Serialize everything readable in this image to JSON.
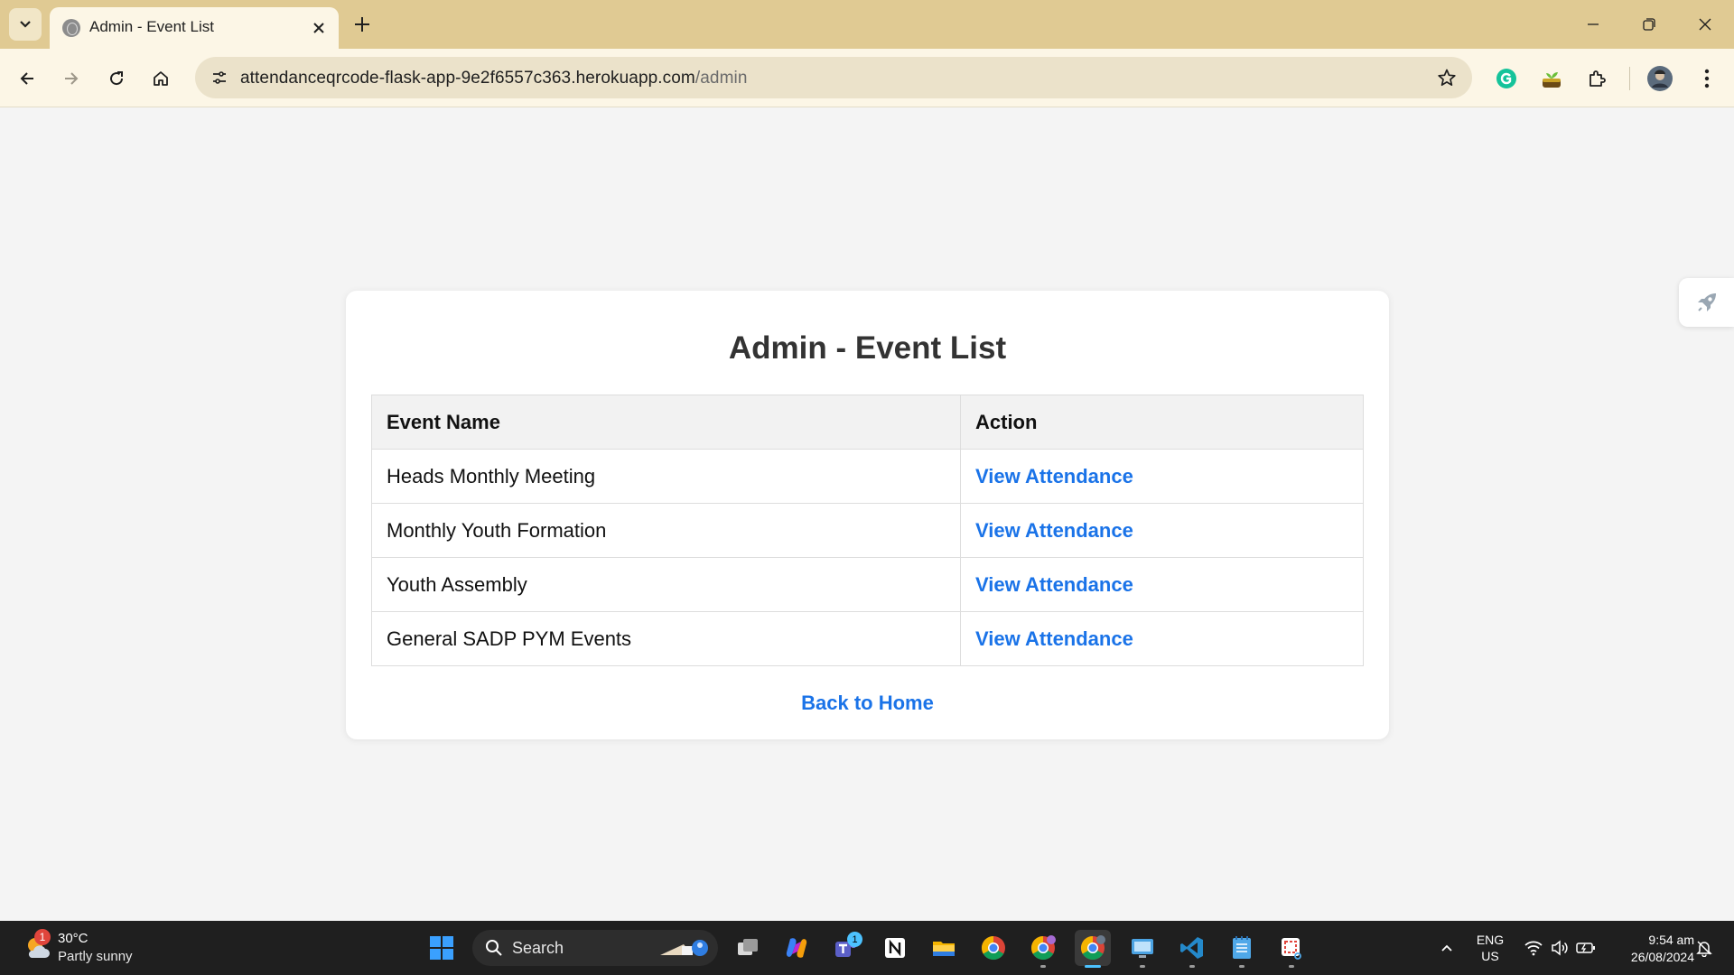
{
  "browser": {
    "tab_title": "Admin - Event List",
    "url_host": "attendanceqrcode-flask-app-9e2f6557c363.herokuapp.com",
    "url_path": "/admin"
  },
  "page": {
    "title": "Admin - Event List",
    "table": {
      "headers": [
        "Event Name",
        "Action"
      ],
      "rows": [
        {
          "event": "Heads Monthly Meeting",
          "action": "View Attendance"
        },
        {
          "event": "Monthly Youth Formation",
          "action": "View Attendance"
        },
        {
          "event": "Youth Assembly",
          "action": "View Attendance"
        },
        {
          "event": "General SADP PYM Events",
          "action": "View Attendance"
        }
      ]
    },
    "back_link": "Back to Home",
    "link_color": "#1a73e8"
  },
  "taskbar": {
    "weather": {
      "temp": "30°C",
      "condition": "Partly sunny",
      "badge": "1"
    },
    "search_label": "Search",
    "teams_badge": "1",
    "language": {
      "line1": "ENG",
      "line2": "US"
    },
    "clock": {
      "time": "9:54 am",
      "date": "26/08/2024"
    }
  }
}
